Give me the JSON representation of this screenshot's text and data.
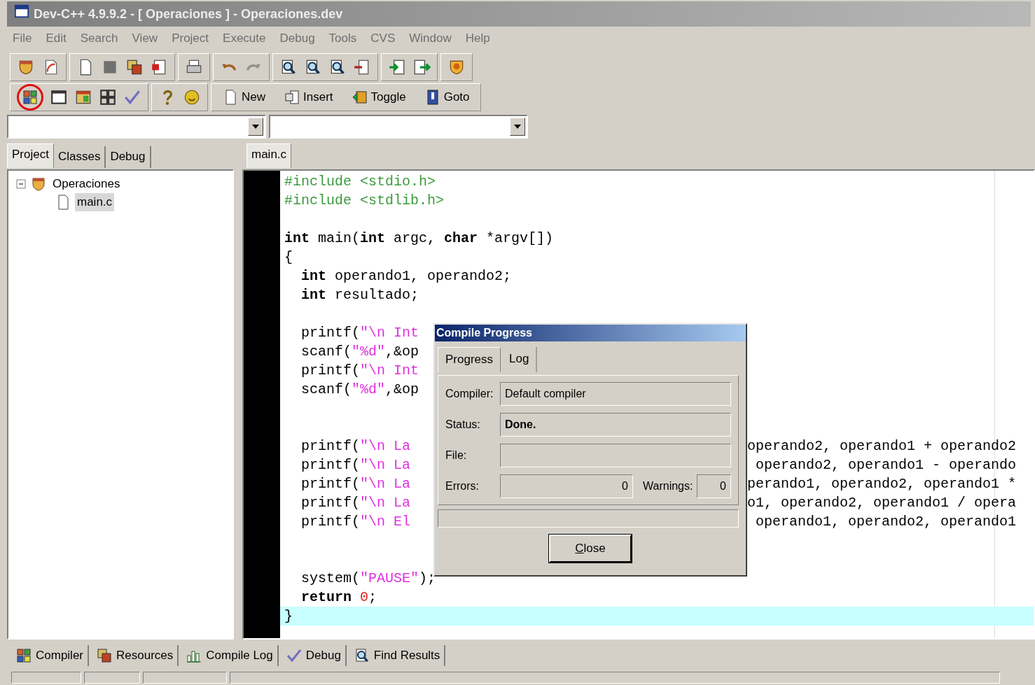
{
  "window": {
    "title": "Dev-C++ 4.9.9.2  - [ Operaciones ] - Operaciones.dev"
  },
  "menu": [
    {
      "label": "File",
      "disabled": true
    },
    {
      "label": "Edit",
      "disabled": true
    },
    {
      "label": "Search",
      "disabled": true
    },
    {
      "label": "View",
      "disabled": true
    },
    {
      "label": "Project",
      "disabled": true
    },
    {
      "label": "Execute",
      "disabled": true
    },
    {
      "label": "Debug",
      "disabled": true
    },
    {
      "label": "Tools",
      "disabled": true
    },
    {
      "label": "CVS",
      "disabled": true
    },
    {
      "label": "Window",
      "disabled": true
    },
    {
      "label": "Help",
      "disabled": true
    }
  ],
  "toolbar_buttons": [
    {
      "label": "New"
    },
    {
      "label": "Insert"
    },
    {
      "label": "Toggle"
    },
    {
      "label": "Goto"
    }
  ],
  "side_tabs": [
    {
      "label": "Project",
      "selected": true
    },
    {
      "label": "Classes",
      "selected": false
    },
    {
      "label": "Debug",
      "selected": false
    }
  ],
  "project_tree": [
    {
      "label": "Operaciones",
      "expanded": true,
      "selected": false,
      "children": [
        {
          "label": "main.c",
          "selected": true
        }
      ]
    }
  ],
  "editor": {
    "tabs": [
      {
        "label": "main.c",
        "selected": true
      }
    ],
    "lines": [
      {
        "current": false,
        "tokens": [
          {
            "text": "#include <stdio.h>",
            "kind": "pre"
          }
        ]
      },
      {
        "current": false,
        "tokens": [
          {
            "text": "#include <stdlib.h>",
            "kind": "pre"
          }
        ]
      },
      {
        "current": false
      },
      {
        "current": false,
        "tokens": [
          {
            "text": "int",
            "kind": "kw"
          },
          {
            "text": " main(",
            "kind": "plain"
          },
          {
            "text": "int",
            "kind": "kw"
          },
          {
            "text": " argc, ",
            "kind": "plain"
          },
          {
            "text": "char",
            "kind": "kw"
          },
          {
            "text": " *argv[])",
            "kind": "plain"
          }
        ]
      },
      {
        "current": false,
        "tokens": [
          {
            "text": "{",
            "kind": "plain"
          }
        ]
      },
      {
        "current": false,
        "tokens": [
          {
            "text": "  int",
            "kind": "kw"
          },
          {
            "text": " operando1, operando2;",
            "kind": "plain"
          }
        ]
      },
      {
        "current": false,
        "tokens": [
          {
            "text": "  int",
            "kind": "kw"
          },
          {
            "text": " resultado;",
            "kind": "plain"
          }
        ]
      },
      {
        "current": false
      },
      {
        "current": false,
        "tokens": [
          {
            "text": "  printf(",
            "kind": "plain"
          },
          {
            "text": "\"\\n Int",
            "kind": "str"
          }
        ]
      },
      {
        "current": false,
        "tokens": [
          {
            "text": "  scanf(",
            "kind": "plain"
          },
          {
            "text": "\"%d\"",
            "kind": "str"
          },
          {
            "text": ",&op",
            "kind": "plain"
          }
        ]
      },
      {
        "current": false,
        "tokens": [
          {
            "text": "  printf(",
            "kind": "plain"
          },
          {
            "text": "\"\\n Int",
            "kind": "str"
          }
        ]
      },
      {
        "current": false,
        "tokens": [
          {
            "text": "  scanf(",
            "kind": "plain"
          },
          {
            "text": "\"%d\"",
            "kind": "str"
          },
          {
            "text": ",&op",
            "kind": "plain"
          }
        ]
      },
      {
        "current": false
      },
      {
        "current": false
      },
      {
        "current": false,
        "tokens": [
          {
            "text": "  printf(",
            "kind": "plain"
          },
          {
            "text": "\"\\n La",
            "kind": "str"
          }
        ],
        "right": "operando2, operando1 + operando2"
      },
      {
        "current": false,
        "tokens": [
          {
            "text": "  printf(",
            "kind": "plain"
          },
          {
            "text": "\"\\n La",
            "kind": "str"
          }
        ],
        "right": " operando2, operando1 - operando"
      },
      {
        "current": false,
        "tokens": [
          {
            "text": "  printf(",
            "kind": "plain"
          },
          {
            "text": "\"\\n La",
            "kind": "str"
          }
        ],
        "right": "perando1, operando2, operando1 *"
      },
      {
        "current": false,
        "tokens": [
          {
            "text": "  printf(",
            "kind": "plain"
          },
          {
            "text": "\"\\n La",
            "kind": "str"
          }
        ],
        "right": "o1, operando2, operando1 / opera"
      },
      {
        "current": false,
        "tokens": [
          {
            "text": "  printf(",
            "kind": "plain"
          },
          {
            "text": "\"\\n El",
            "kind": "str"
          }
        ],
        "right": " operando1, operando2, operando1"
      },
      {
        "current": false
      },
      {
        "current": false
      },
      {
        "current": false,
        "tokens": [
          {
            "text": "  system(",
            "kind": "plain"
          },
          {
            "text": "\"PAUSE\"",
            "kind": "str"
          },
          {
            "text": ");",
            "kind": "plain"
          }
        ]
      },
      {
        "current": false,
        "tokens": [
          {
            "text": "  return",
            "kind": "kw"
          },
          {
            "text": " 0",
            "kind": "num"
          },
          {
            "text": ";",
            "kind": "plain"
          }
        ]
      },
      {
        "current": true,
        "tokens": [
          {
            "text": "}",
            "kind": "plain"
          }
        ]
      }
    ]
  },
  "dialog": {
    "title": "Compile Progress",
    "tabs": [
      {
        "label": "Progress",
        "selected": true
      },
      {
        "label": "Log",
        "selected": false
      }
    ],
    "compiler": {
      "label": "Compiler:",
      "value": "Default compiler"
    },
    "status": {
      "label": "Status:",
      "value": "Done."
    },
    "file": {
      "label": "File:"
    },
    "errors": {
      "label": "Errors:",
      "value": "0"
    },
    "warnings": {
      "label": "Warnings:",
      "value": "0"
    },
    "progress": {
      "level": 0
    },
    "close_button": "Close"
  },
  "bottom_tabs": [
    {
      "label": "Compiler"
    },
    {
      "label": "Resources"
    },
    {
      "label": "Compile Log"
    },
    {
      "label": "Debug"
    },
    {
      "label": "Find Results"
    }
  ]
}
